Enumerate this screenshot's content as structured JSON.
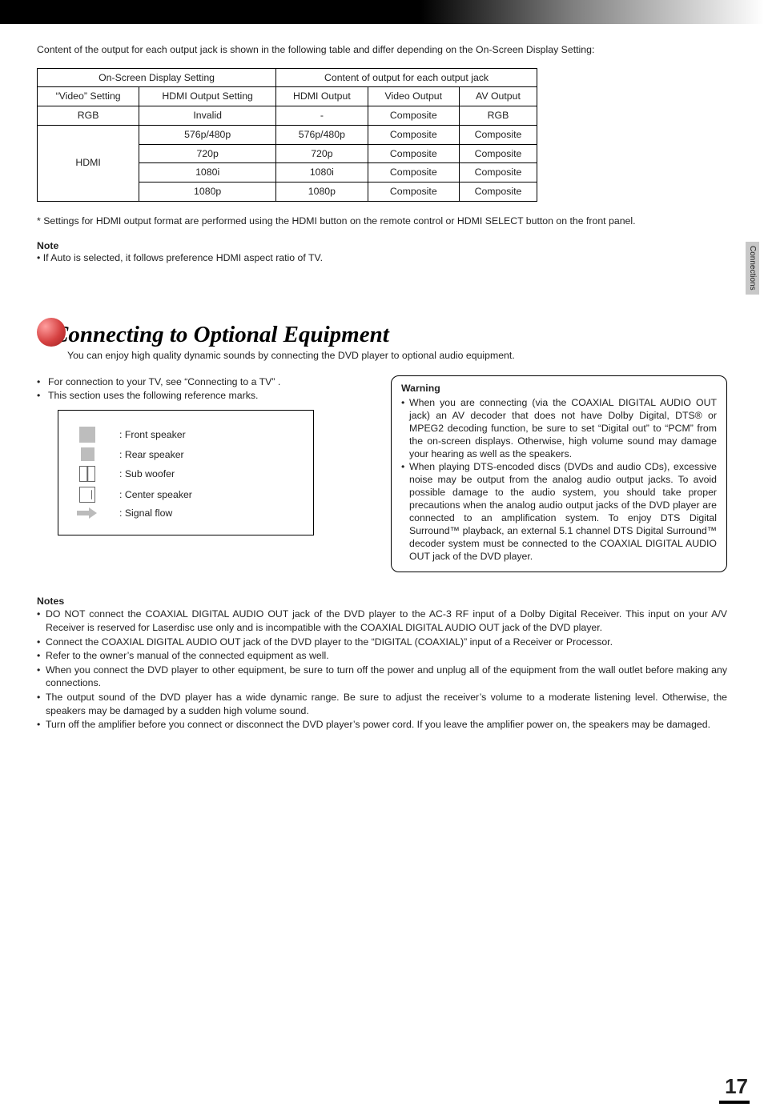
{
  "page_number": "17",
  "sidetab": "Connections",
  "intro": "Content of the output for each output jack is shown in the following table and differ depending on the On-Screen Display Setting:",
  "table": {
    "hdr_osd": "On-Screen Display Setting",
    "hdr_content": "Content of output for each output jack",
    "col_video": "“Video” Setting",
    "col_hdmiout_setting": "HDMI Output Setting",
    "col_hdmi": "HDMI Output",
    "col_videoout": "Video Output",
    "col_av": "AV Output",
    "rows": [
      {
        "video": "RGB",
        "hdmiset": "Invalid",
        "hdmi": "-",
        "vout": "Composite",
        "av": "RGB"
      },
      {
        "video": "HDMI",
        "hdmiset": "576p/480p",
        "hdmi": "576p/480p",
        "vout": "Composite",
        "av": "Composite"
      },
      {
        "video": "HDMI",
        "hdmiset": "720p",
        "hdmi": "720p",
        "vout": "Composite",
        "av": "Composite"
      },
      {
        "video": "HDMI",
        "hdmiset": "1080i",
        "hdmi": "1080i",
        "vout": "Composite",
        "av": "Composite"
      },
      {
        "video": "HDMI",
        "hdmiset": "1080p",
        "hdmi": "1080p",
        "vout": "Composite",
        "av": "Composite"
      }
    ]
  },
  "footnote": "* Settings for HDMI output format are performed using the HDMI button on the remote control or HDMI SELECT button on the front panel.",
  "note_head": "Note",
  "note_body": "• If Auto is selected, it follows preference HDMI aspect ratio of TV.",
  "heading": "Connecting to Optional Equipment",
  "subtitle": "You can enjoy high quality dynamic sounds by connecting the DVD player to optional audio equipment.",
  "left_bullets": [
    "For connection to your TV, see “Connecting to a TV” .",
    "This section uses the following reference marks."
  ],
  "legend": {
    "front": ": Front speaker",
    "rear": ": Rear speaker",
    "sub": ": Sub woofer",
    "center": ": Center speaker",
    "signal": ": Signal flow"
  },
  "warning_head": "Warning",
  "warning_items": [
    "When you are connecting (via the COAXIAL DIGITAL AUDIO OUT jack) an AV decoder that does not have Dolby Digital, DTS® or MPEG2 decoding function, be sure to set “Digital out” to “PCM” from the on-screen displays. Otherwise, high volume sound may damage your hearing as well as the speakers.",
    "When playing DTS-encoded discs (DVDs and audio CDs), excessive noise may be output from the analog audio output jacks. To avoid possible damage to the audio system, you should take proper precautions when the analog audio output jacks of the DVD player are connected to an amplification system. To enjoy DTS Digital Surround™ playback, an external 5.1 channel DTS Digital Surround™ decoder system must be connected to the COAXIAL DIGITAL AUDIO OUT jack of the DVD player."
  ],
  "notes_head": "Notes",
  "notes_items": [
    "DO NOT connect the COAXIAL DIGITAL AUDIO OUT jack of the DVD player to the AC-3 RF input of a Dolby Digital Receiver.  This input on your A/V Receiver is reserved for Laserdisc use only and is incompatible with the COAXIAL DIGITAL AUDIO OUT jack of the DVD player.",
    "Connect the COAXIAL DIGITAL AUDIO OUT jack of the DVD player to the “DIGITAL (COAXIAL)” input of a Receiver or Processor.",
    "Refer to the owner’s manual of the connected equipment as well.",
    "When you connect the DVD player to other equipment, be sure to turn off the power and unplug all of the equipment from the wall outlet before making any connections.",
    "The output sound of the DVD player has a wide dynamic range. Be sure to adjust the receiver’s volume to a moderate listening level. Otherwise, the speakers may be damaged by a sudden high volume sound.",
    "Turn off the amplifier before you connect or disconnect the DVD player’s power cord. If you leave the amplifier power on, the speakers may be damaged."
  ]
}
